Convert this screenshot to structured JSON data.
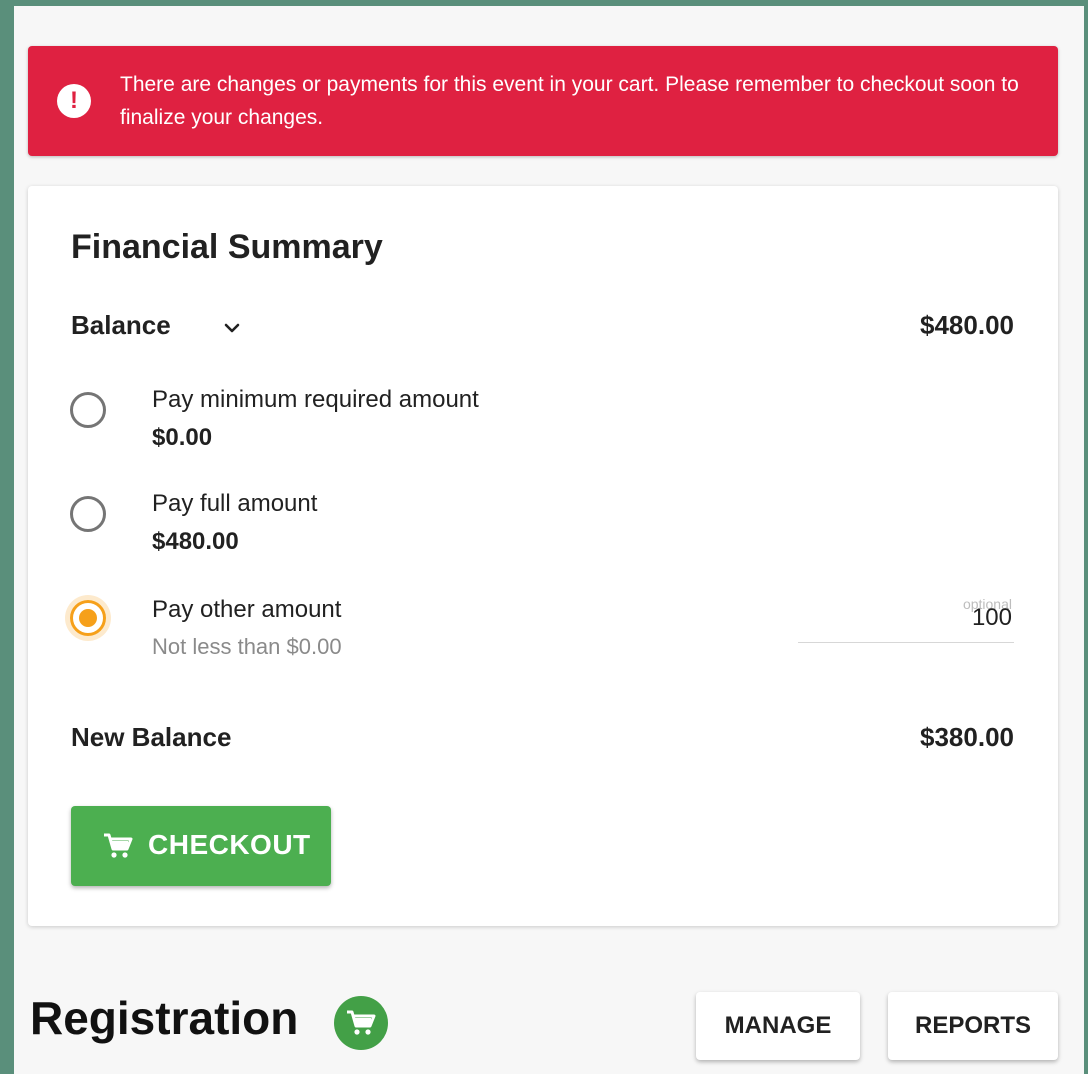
{
  "alert": {
    "icon": "exclamation-icon",
    "message": "There are changes or payments for this event in your cart. Please remember to checkout soon to finalize your changes.",
    "color": "#df2141"
  },
  "summary": {
    "title": "Financial Summary",
    "balance_label": "Balance",
    "balance_amount": "$480.00",
    "options": [
      {
        "label": "Pay minimum required amount",
        "amount": "$0.00",
        "selected": false
      },
      {
        "label": "Pay full amount",
        "amount": "$480.00",
        "selected": false
      },
      {
        "label": "Pay other amount",
        "hint": "Not less than $0.00",
        "selected": true
      }
    ],
    "other_amount": {
      "placeholder": "optional",
      "value": "100"
    },
    "new_balance_label": "New Balance",
    "new_balance_amount": "$380.00",
    "checkout_label": "CHECKOUT",
    "accent_color": "#f6a01a",
    "checkout_color": "#4caf50"
  },
  "registration": {
    "title": "Registration",
    "cart_icon": "cart-icon",
    "manage_label": "MANAGE",
    "reports_label": "REPORTS"
  }
}
